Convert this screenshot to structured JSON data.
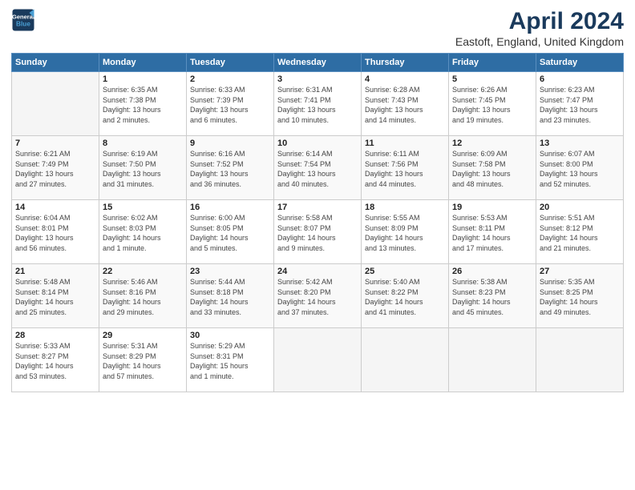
{
  "header": {
    "logo_line1": "General",
    "logo_line2": "Blue",
    "month_title": "April 2024",
    "location": "Eastoft, England, United Kingdom"
  },
  "weekdays": [
    "Sunday",
    "Monday",
    "Tuesday",
    "Wednesday",
    "Thursday",
    "Friday",
    "Saturday"
  ],
  "weeks": [
    [
      {
        "day": "",
        "info": ""
      },
      {
        "day": "1",
        "info": "Sunrise: 6:35 AM\nSunset: 7:38 PM\nDaylight: 13 hours\nand 2 minutes."
      },
      {
        "day": "2",
        "info": "Sunrise: 6:33 AM\nSunset: 7:39 PM\nDaylight: 13 hours\nand 6 minutes."
      },
      {
        "day": "3",
        "info": "Sunrise: 6:31 AM\nSunset: 7:41 PM\nDaylight: 13 hours\nand 10 minutes."
      },
      {
        "day": "4",
        "info": "Sunrise: 6:28 AM\nSunset: 7:43 PM\nDaylight: 13 hours\nand 14 minutes."
      },
      {
        "day": "5",
        "info": "Sunrise: 6:26 AM\nSunset: 7:45 PM\nDaylight: 13 hours\nand 19 minutes."
      },
      {
        "day": "6",
        "info": "Sunrise: 6:23 AM\nSunset: 7:47 PM\nDaylight: 13 hours\nand 23 minutes."
      }
    ],
    [
      {
        "day": "7",
        "info": "Sunrise: 6:21 AM\nSunset: 7:49 PM\nDaylight: 13 hours\nand 27 minutes."
      },
      {
        "day": "8",
        "info": "Sunrise: 6:19 AM\nSunset: 7:50 PM\nDaylight: 13 hours\nand 31 minutes."
      },
      {
        "day": "9",
        "info": "Sunrise: 6:16 AM\nSunset: 7:52 PM\nDaylight: 13 hours\nand 36 minutes."
      },
      {
        "day": "10",
        "info": "Sunrise: 6:14 AM\nSunset: 7:54 PM\nDaylight: 13 hours\nand 40 minutes."
      },
      {
        "day": "11",
        "info": "Sunrise: 6:11 AM\nSunset: 7:56 PM\nDaylight: 13 hours\nand 44 minutes."
      },
      {
        "day": "12",
        "info": "Sunrise: 6:09 AM\nSunset: 7:58 PM\nDaylight: 13 hours\nand 48 minutes."
      },
      {
        "day": "13",
        "info": "Sunrise: 6:07 AM\nSunset: 8:00 PM\nDaylight: 13 hours\nand 52 minutes."
      }
    ],
    [
      {
        "day": "14",
        "info": "Sunrise: 6:04 AM\nSunset: 8:01 PM\nDaylight: 13 hours\nand 56 minutes."
      },
      {
        "day": "15",
        "info": "Sunrise: 6:02 AM\nSunset: 8:03 PM\nDaylight: 14 hours\nand 1 minute."
      },
      {
        "day": "16",
        "info": "Sunrise: 6:00 AM\nSunset: 8:05 PM\nDaylight: 14 hours\nand 5 minutes."
      },
      {
        "day": "17",
        "info": "Sunrise: 5:58 AM\nSunset: 8:07 PM\nDaylight: 14 hours\nand 9 minutes."
      },
      {
        "day": "18",
        "info": "Sunrise: 5:55 AM\nSunset: 8:09 PM\nDaylight: 14 hours\nand 13 minutes."
      },
      {
        "day": "19",
        "info": "Sunrise: 5:53 AM\nSunset: 8:11 PM\nDaylight: 14 hours\nand 17 minutes."
      },
      {
        "day": "20",
        "info": "Sunrise: 5:51 AM\nSunset: 8:12 PM\nDaylight: 14 hours\nand 21 minutes."
      }
    ],
    [
      {
        "day": "21",
        "info": "Sunrise: 5:48 AM\nSunset: 8:14 PM\nDaylight: 14 hours\nand 25 minutes."
      },
      {
        "day": "22",
        "info": "Sunrise: 5:46 AM\nSunset: 8:16 PM\nDaylight: 14 hours\nand 29 minutes."
      },
      {
        "day": "23",
        "info": "Sunrise: 5:44 AM\nSunset: 8:18 PM\nDaylight: 14 hours\nand 33 minutes."
      },
      {
        "day": "24",
        "info": "Sunrise: 5:42 AM\nSunset: 8:20 PM\nDaylight: 14 hours\nand 37 minutes."
      },
      {
        "day": "25",
        "info": "Sunrise: 5:40 AM\nSunset: 8:22 PM\nDaylight: 14 hours\nand 41 minutes."
      },
      {
        "day": "26",
        "info": "Sunrise: 5:38 AM\nSunset: 8:23 PM\nDaylight: 14 hours\nand 45 minutes."
      },
      {
        "day": "27",
        "info": "Sunrise: 5:35 AM\nSunset: 8:25 PM\nDaylight: 14 hours\nand 49 minutes."
      }
    ],
    [
      {
        "day": "28",
        "info": "Sunrise: 5:33 AM\nSunset: 8:27 PM\nDaylight: 14 hours\nand 53 minutes."
      },
      {
        "day": "29",
        "info": "Sunrise: 5:31 AM\nSunset: 8:29 PM\nDaylight: 14 hours\nand 57 minutes."
      },
      {
        "day": "30",
        "info": "Sunrise: 5:29 AM\nSunset: 8:31 PM\nDaylight: 15 hours\nand 1 minute."
      },
      {
        "day": "",
        "info": ""
      },
      {
        "day": "",
        "info": ""
      },
      {
        "day": "",
        "info": ""
      },
      {
        "day": "",
        "info": ""
      }
    ]
  ]
}
